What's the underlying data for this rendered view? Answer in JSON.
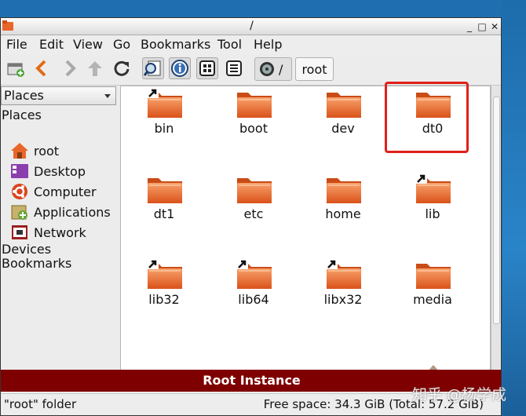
{
  "window": {
    "title": "/"
  },
  "menu": [
    "File",
    "Edit",
    "View",
    "Go",
    "Bookmarks",
    "Tool",
    "Help"
  ],
  "toolbar": {
    "buttons": [
      "new-tab-icon",
      "back-arrow-icon",
      "forward-arrow-icon",
      "up-arrow-icon",
      "reload-icon",
      "search-icon",
      "info-icon",
      "icon-view-icon",
      "list-view-icon"
    ],
    "path_root": "/",
    "path_current": "root"
  },
  "sidebar": {
    "selector": "Places",
    "places_heading": "Places",
    "items": [
      {
        "label": "root",
        "icon": "home-folder-icon"
      },
      {
        "label": "Desktop",
        "icon": "desktop-icon"
      },
      {
        "label": "Computer",
        "icon": "computer-icon"
      },
      {
        "label": "Applications",
        "icon": "applications-icon"
      },
      {
        "label": "Network",
        "icon": "network-icon"
      }
    ],
    "devices_heading": "Devices",
    "bookmarks_heading": "Bookmarks"
  },
  "files": [
    {
      "name": "bin",
      "link": true
    },
    {
      "name": "boot",
      "link": false
    },
    {
      "name": "dev",
      "link": false
    },
    {
      "name": "dt0",
      "link": false
    },
    {
      "name": "dt1",
      "link": false
    },
    {
      "name": "etc",
      "link": false
    },
    {
      "name": "home",
      "link": false
    },
    {
      "name": "lib",
      "link": true
    },
    {
      "name": "lib32",
      "link": true
    },
    {
      "name": "lib64",
      "link": true
    },
    {
      "name": "libx32",
      "link": true
    },
    {
      "name": "media",
      "link": false
    }
  ],
  "banner": "Root Instance",
  "status": {
    "left": "\"root\" folder",
    "right": "Free space: 34.3 GiB (Total: 57.2 GiB)"
  },
  "watermark": "知乎 @杨学成",
  "colors": {
    "folder": "#e8662a",
    "banner": "#7f0000",
    "highlight": "#e0201a"
  }
}
